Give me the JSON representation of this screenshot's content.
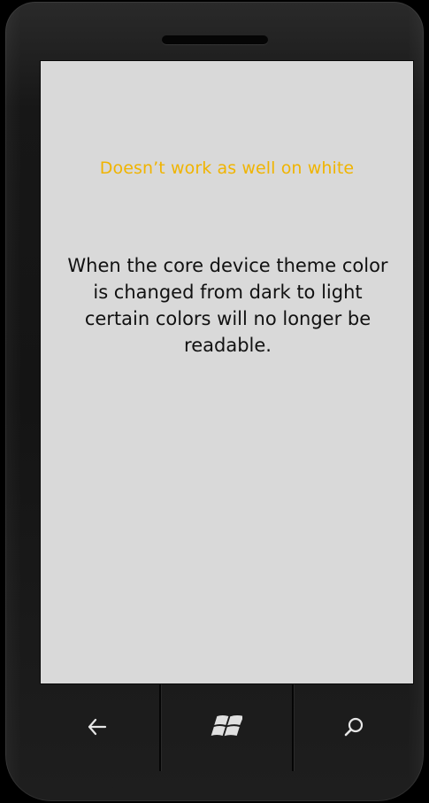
{
  "screen": {
    "heading": "Doesn’t work as well on white",
    "body": "When the core device theme color is changed from dark to light certain colors will no longer be readable.",
    "heading_color": "#f0b400",
    "background_color": "#d9d9d9"
  },
  "hardware_buttons": {
    "back": "back-arrow-icon",
    "start": "windows-logo-icon",
    "search": "search-icon"
  }
}
